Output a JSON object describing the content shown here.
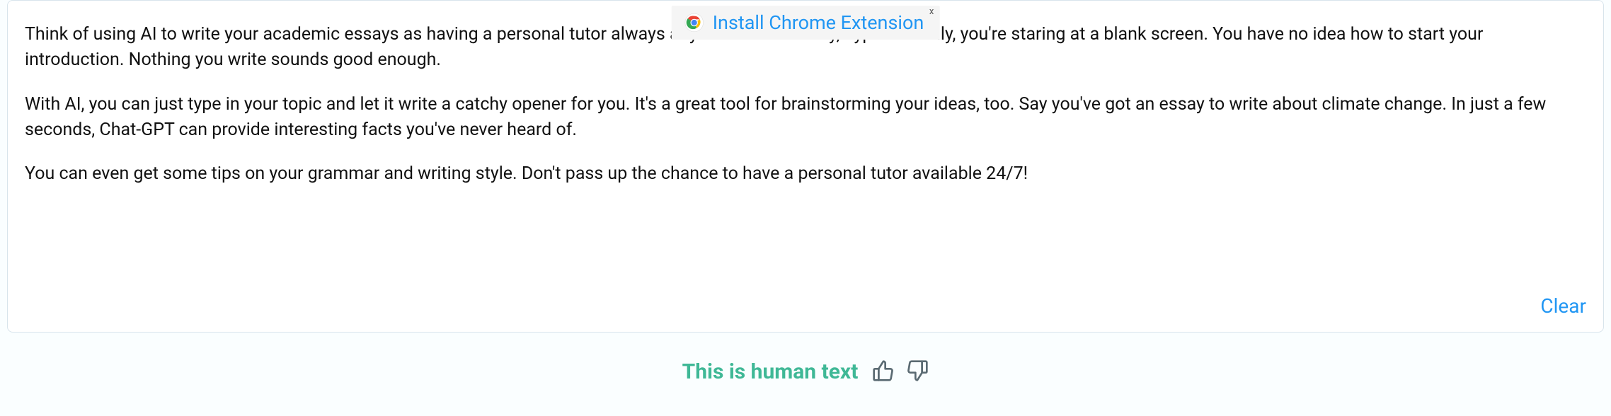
{
  "banner": {
    "label": "Install Chrome Extension",
    "close": "x"
  },
  "paragraphs": [
    "Think of using AI to write your academic essays as having a personal tutor always at your side. Let's say, hypothetically, you're staring at a blank screen. You have no idea how to start your introduction. Nothing you write sounds good enough.",
    "With AI, you can just type in your topic and let it write a catchy opener for you. It's a great tool for brainstorming your ideas, too. Say you've got an essay to write about climate change. In just a few seconds, Chat-GPT can provide interesting facts you've never heard of.",
    "You can even get some tips on your grammar and writing style. Don't pass up the chance to have a personal tutor available 24/7!"
  ],
  "actions": {
    "clear": "Clear"
  },
  "result": {
    "verdict": "This is human text"
  }
}
